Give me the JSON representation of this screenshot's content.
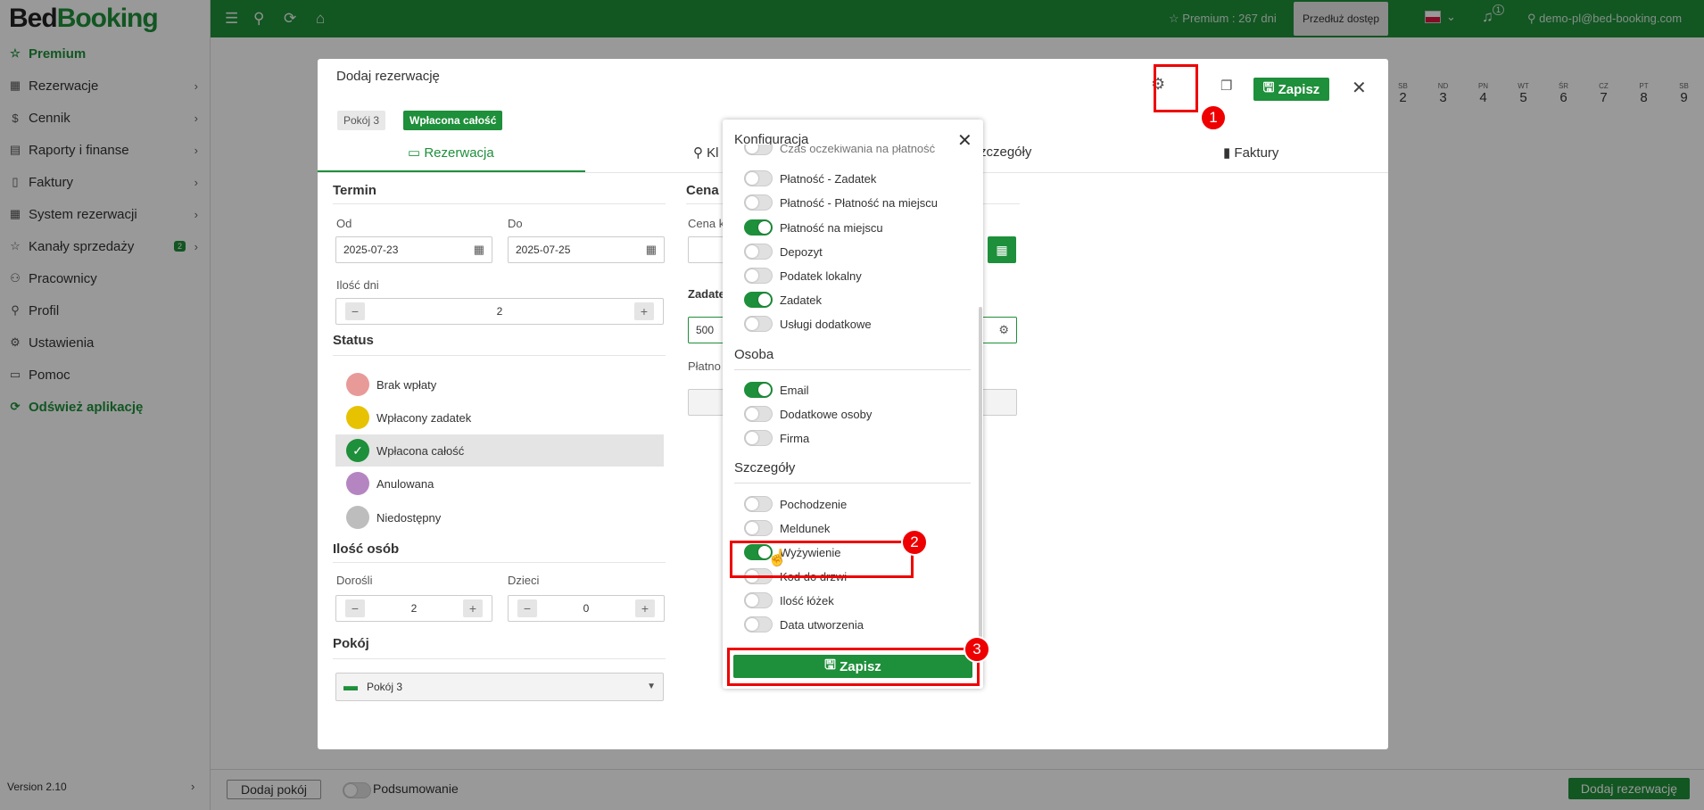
{
  "app": {
    "logo_bed": "Bed",
    "logo_booking": "Booking"
  },
  "sidebar": {
    "items": [
      {
        "label": "Premium",
        "icon": "star-icon"
      },
      {
        "label": "Rezerwacje",
        "icon": "calendar-icon"
      },
      {
        "label": "Cennik",
        "icon": "dollar-icon"
      },
      {
        "label": "Raporty i finanse",
        "icon": "chart-icon"
      },
      {
        "label": "Faktury",
        "icon": "invoice-icon"
      },
      {
        "label": "System rezerwacji",
        "icon": "grid-icon"
      },
      {
        "label": "Kanały sprzedaży",
        "icon": "share-icon",
        "badge": "2"
      },
      {
        "label": "Pracownicy",
        "icon": "users-icon"
      },
      {
        "label": "Profil",
        "icon": "user-icon"
      },
      {
        "label": "Ustawienia",
        "icon": "settings-icon"
      },
      {
        "label": "Pomoc",
        "icon": "help-icon"
      },
      {
        "label": "Odśwież aplikację",
        "icon": "refresh-icon"
      }
    ],
    "version": "Version 2.10"
  },
  "topbar": {
    "premium": "Premium : 267 dni",
    "extend": "Przedłuż dostęp",
    "bell_count": "1",
    "user": "demo-pl@bed-booking.com"
  },
  "calendar": {
    "days": [
      {
        "dow": "SB",
        "num": "2"
      },
      {
        "dow": "ND",
        "num": "3"
      },
      {
        "dow": "PN",
        "num": "4"
      },
      {
        "dow": "WT",
        "num": "5"
      },
      {
        "dow": "ŚR",
        "num": "6"
      },
      {
        "dow": "CZ",
        "num": "7"
      },
      {
        "dow": "PT",
        "num": "8"
      },
      {
        "dow": "SB",
        "num": "9"
      }
    ]
  },
  "modal": {
    "title": "Dodaj rezerwację",
    "room_pill": "Pokój 3",
    "status_pill": "Wpłacona całość",
    "save": "Zapisz",
    "tabs": {
      "reservation": "Rezerwacja",
      "client": "Kl",
      "details": "zczegóły",
      "invoices": "Faktury"
    },
    "term": {
      "title": "Termin",
      "from_label": "Od",
      "from_value": "2025-07-23",
      "to_label": "Do",
      "to_value": "2025-07-25",
      "days_label": "Ilość dni",
      "days_value": "2"
    },
    "status": {
      "title": "Status",
      "options": [
        {
          "label": "Brak wpłaty",
          "color": "#e89a98"
        },
        {
          "label": "Wpłacony zadatek",
          "color": "#e6c200"
        },
        {
          "label": "Wpłacona całość",
          "color": "#1e8f3a"
        },
        {
          "label": "Anulowana",
          "color": "#b585c2"
        },
        {
          "label": "Niedostępny",
          "color": "#bdbdbd"
        }
      ]
    },
    "persons": {
      "title": "Ilość osób",
      "adults_label": "Dorośli",
      "adults_value": "2",
      "children_label": "Dzieci",
      "children_value": "0"
    },
    "room": {
      "title": "Pokój",
      "value": "Pokój 3"
    },
    "price": {
      "title": "Cena",
      "cena_label": "Cena k",
      "zadatek_label": "Zadate",
      "zadatek_value": "500",
      "platnosc_label": "Płatno"
    }
  },
  "config": {
    "title": "Konfiguracja",
    "top_items": [
      {
        "label": "Czas oczekiwania na płatność",
        "on": false
      },
      {
        "label": "Płatność - Zadatek",
        "on": false
      },
      {
        "label": "Płatność - Płatność na miejscu",
        "on": false
      },
      {
        "label": "Płatność na miejscu",
        "on": true
      },
      {
        "label": "Depozyt",
        "on": false
      },
      {
        "label": "Podatek lokalny",
        "on": false
      },
      {
        "label": "Zadatek",
        "on": true
      },
      {
        "label": "Usługi dodatkowe",
        "on": false
      }
    ],
    "person_title": "Osoba",
    "person_items": [
      {
        "label": "Email",
        "on": true
      },
      {
        "label": "Dodatkowe osoby",
        "on": false
      },
      {
        "label": "Firma",
        "on": false
      }
    ],
    "details_title": "Szczegóły",
    "details_items": [
      {
        "label": "Pochodzenie",
        "on": false
      },
      {
        "label": "Meldunek",
        "on": false
      },
      {
        "label": "Wyżywienie",
        "on": true
      },
      {
        "label": "Kod do drzwi",
        "on": false
      },
      {
        "label": "Ilość łóżek",
        "on": false
      },
      {
        "label": "Data utworzenia",
        "on": false
      }
    ],
    "save": "Zapisz"
  },
  "annotations": [
    "1",
    "2",
    "3"
  ],
  "bottom": {
    "add_room": "Dodaj pokój",
    "summary": "Podsumowanie",
    "add_reservation": "Dodaj rezerwację"
  },
  "colors": {
    "brand": "#1e8f3a",
    "annotation": "#ee0000"
  }
}
